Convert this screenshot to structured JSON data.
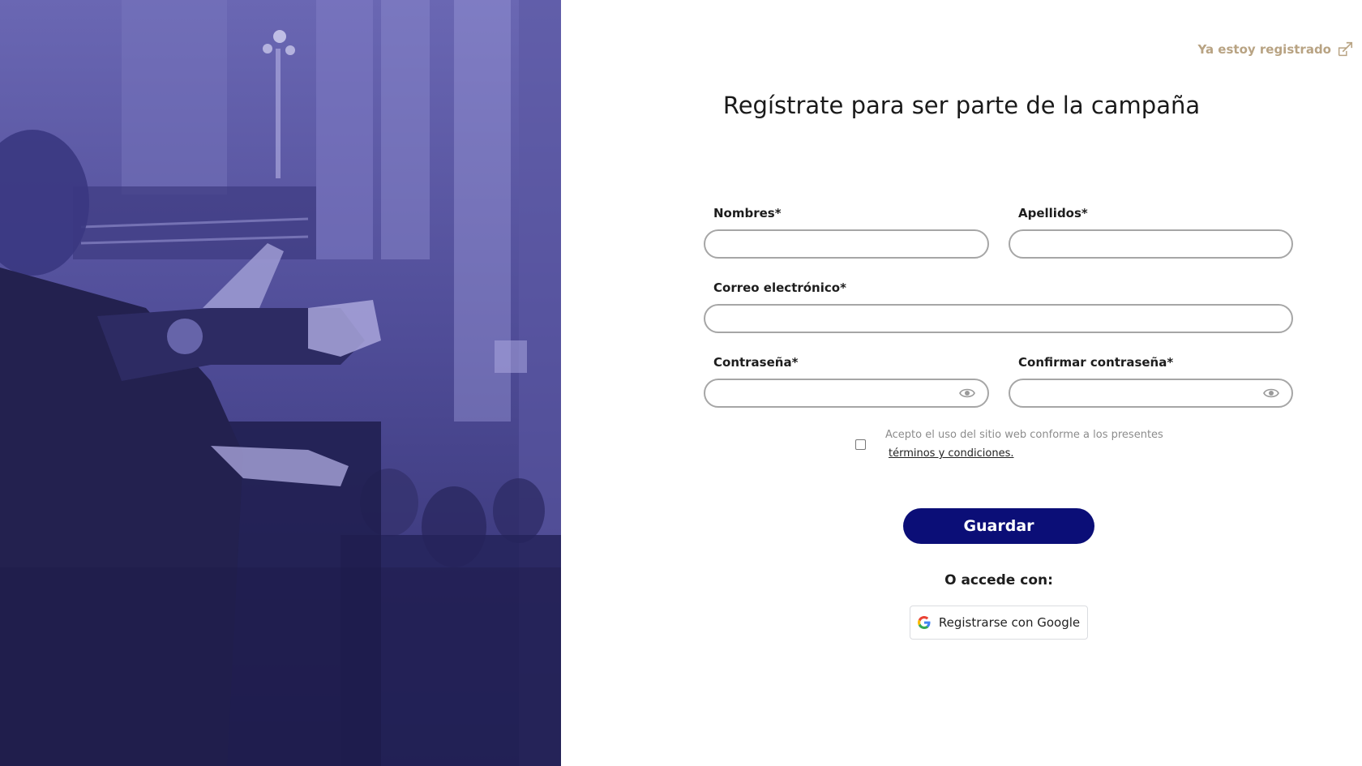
{
  "header": {
    "already_registered": "Ya estoy registrado"
  },
  "form": {
    "title": "Regístrate para ser parte de la campaña",
    "first_name_label": "Nombres*",
    "last_name_label": "Apellidos*",
    "email_label": "Correo electrónico*",
    "password_label": "Contraseña*",
    "confirm_password_label": "Confirmar contraseña*",
    "first_name_value": "",
    "last_name_value": "",
    "email_value": "",
    "password_value": "",
    "confirm_password_value": "",
    "terms_text": "Acepto el uso del sitio web conforme a los presentes",
    "terms_link": "términos y condiciones.",
    "terms_checked": false,
    "save_label": "Guardar",
    "or_access_label": "O accede con:",
    "google_label": "Registrarse con Google"
  },
  "colors": {
    "accent": "#0b0e77",
    "link_gold": "#b8a383",
    "hero_tint": "#4f4c97"
  },
  "icons": {
    "already_registered": "sign-in-icon",
    "password_toggle": "eye-icon",
    "google": "google-icon"
  }
}
